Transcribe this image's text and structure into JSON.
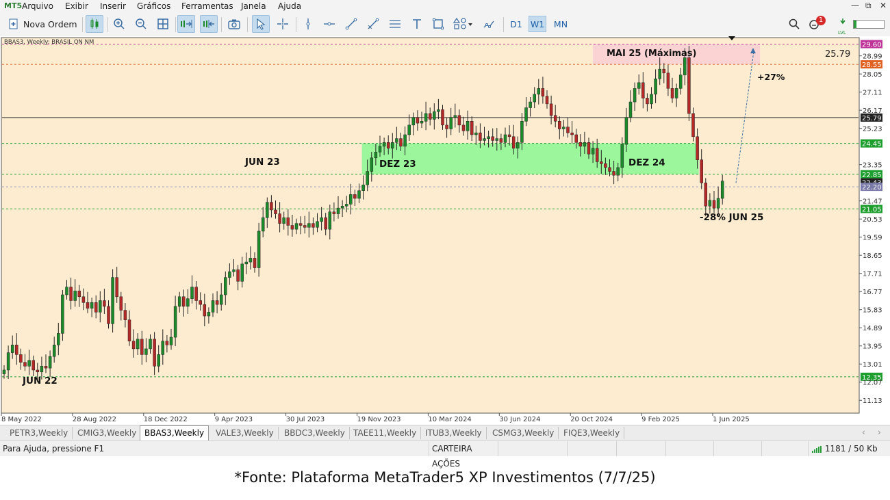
{
  "app": {
    "logo": "MT5"
  },
  "menu": [
    "Arquivo",
    "Exibir",
    "Inserir",
    "Gráficos",
    "Ferramentas",
    "Janela",
    "Ajuda"
  ],
  "toolbar": {
    "new_order_label": "Nova Ordem",
    "timeframes": [
      "D1",
      "W1",
      "MN"
    ],
    "active_timeframe": "W1",
    "notification_count": "1",
    "lvl_label": "LVL"
  },
  "chart": {
    "info_line": "BBAS3, Weekly:  BRASIL      ON       NM",
    "current_price_label": "25.79",
    "price_labels": [
      "29.60",
      "28.99",
      "28.55",
      "28.05",
      "27.11",
      "26.17",
      "25.79",
      "25.23",
      "24.45",
      "23.35",
      "22.85",
      "22.43",
      "22.20",
      "21.47",
      "21.05",
      "20.53",
      "19.59",
      "18.65",
      "17.71",
      "16.77",
      "15.83",
      "14.89",
      "13.95",
      "13.01",
      "12.35",
      "12.07",
      "11.13"
    ],
    "time_labels": [
      "8 May 2022",
      "28 Aug 2022",
      "18 Dec 2022",
      "9 Apr 2023",
      "30 Jul 2023",
      "19 Nov 2023",
      "10 Mar 2024",
      "30 Jun 2024",
      "20 Oct 2024",
      "9 Feb 2025",
      "1 Jun 2025"
    ],
    "annotations": {
      "jun22": "JUN 22",
      "jun23": "JUN 23",
      "dez23": "DEZ 23",
      "dez24": "DEZ 24",
      "mai25": "MAI 25 (Máximas)",
      "jun25": "-28% JUN 25",
      "up27": "+27%"
    },
    "colors": {
      "background": "#fdecd0",
      "up": "#1b8a2a",
      "down": "#b42828",
      "zone_green": "#9cf79c",
      "zone_red": "#fbd3d3"
    }
  },
  "chart_data": {
    "type": "candlestick",
    "title": "BBAS3, Weekly",
    "ylim": [
      10.5,
      29.9
    ],
    "x_start": "8 May 2022",
    "x_end": "1 Jun 2025",
    "horizontal_levels": [
      29.6,
      28.55,
      25.79,
      24.45,
      22.85,
      22.2,
      21.05,
      12.35
    ],
    "zones": [
      {
        "label": "DEZ 23 – DEZ 24",
        "from": 22.85,
        "to": 24.45
      },
      {
        "label": "MAI 25 (Máximas)",
        "from": 28.55,
        "to": 29.6
      }
    ],
    "close": [
      12.7,
      13.6,
      14.0,
      13.5,
      13.1,
      12.9,
      13.2,
      12.7,
      12.6,
      12.9,
      12.8,
      13.4,
      14.0,
      14.6,
      16.6,
      17.0,
      16.3,
      16.8,
      16.5,
      16.2,
      15.9,
      16.2,
      15.7,
      16.3,
      16.0,
      15.1,
      17.5,
      16.5,
      15.8,
      15.3,
      14.2,
      13.8,
      14.3,
      13.5,
      13.8,
      14.3,
      12.9,
      13.5,
      14.2,
      14.0,
      14.4,
      16.0,
      16.5,
      16.0,
      16.4,
      17.0,
      16.3,
      16.1,
      15.5,
      15.7,
      16.3,
      16.1,
      16.6,
      17.5,
      17.8,
      17.9,
      17.3,
      18.2,
      18.3,
      18.5,
      18.0,
      19.9,
      20.6,
      21.4,
      21.0,
      20.8,
      20.3,
      20.6,
      20.2,
      20.0,
      20.3,
      20.2,
      20.1,
      20.3,
      20.1,
      20.4,
      20.6,
      20.0,
      20.9,
      20.8,
      21.1,
      21.2,
      21.3,
      21.8,
      21.6,
      22.0,
      22.3,
      23.0,
      23.7,
      24.0,
      24.3,
      24.5,
      24.2,
      24.5,
      24.7,
      24.3,
      24.9,
      25.4,
      25.8,
      25.5,
      25.6,
      26.0,
      25.7,
      26.1,
      26.2,
      25.4,
      25.2,
      25.8,
      25.9,
      25.4,
      25.1,
      25.6,
      24.9,
      25.0,
      24.6,
      24.7,
      24.8,
      24.6,
      24.7,
      24.5,
      24.9,
      24.8,
      24.2,
      24.5,
      25.6,
      26.3,
      26.6,
      27.0,
      27.3,
      26.9,
      26.5,
      25.9,
      25.6,
      25.2,
      25.3,
      25.0,
      24.9,
      24.5,
      24.3,
      24.5,
      23.9,
      24.2,
      23.5,
      23.4,
      23.2,
      23.0,
      22.8,
      23.2,
      24.4,
      25.8,
      26.6,
      27.3,
      27.6,
      26.8,
      26.5,
      27.0,
      27.8,
      28.3,
      28.1,
      27.3,
      26.8,
      27.3,
      28.0,
      28.9,
      26.0,
      24.8,
      23.6,
      22.4,
      21.2,
      21.5,
      21.1,
      21.6,
      22.5
    ]
  }
}
